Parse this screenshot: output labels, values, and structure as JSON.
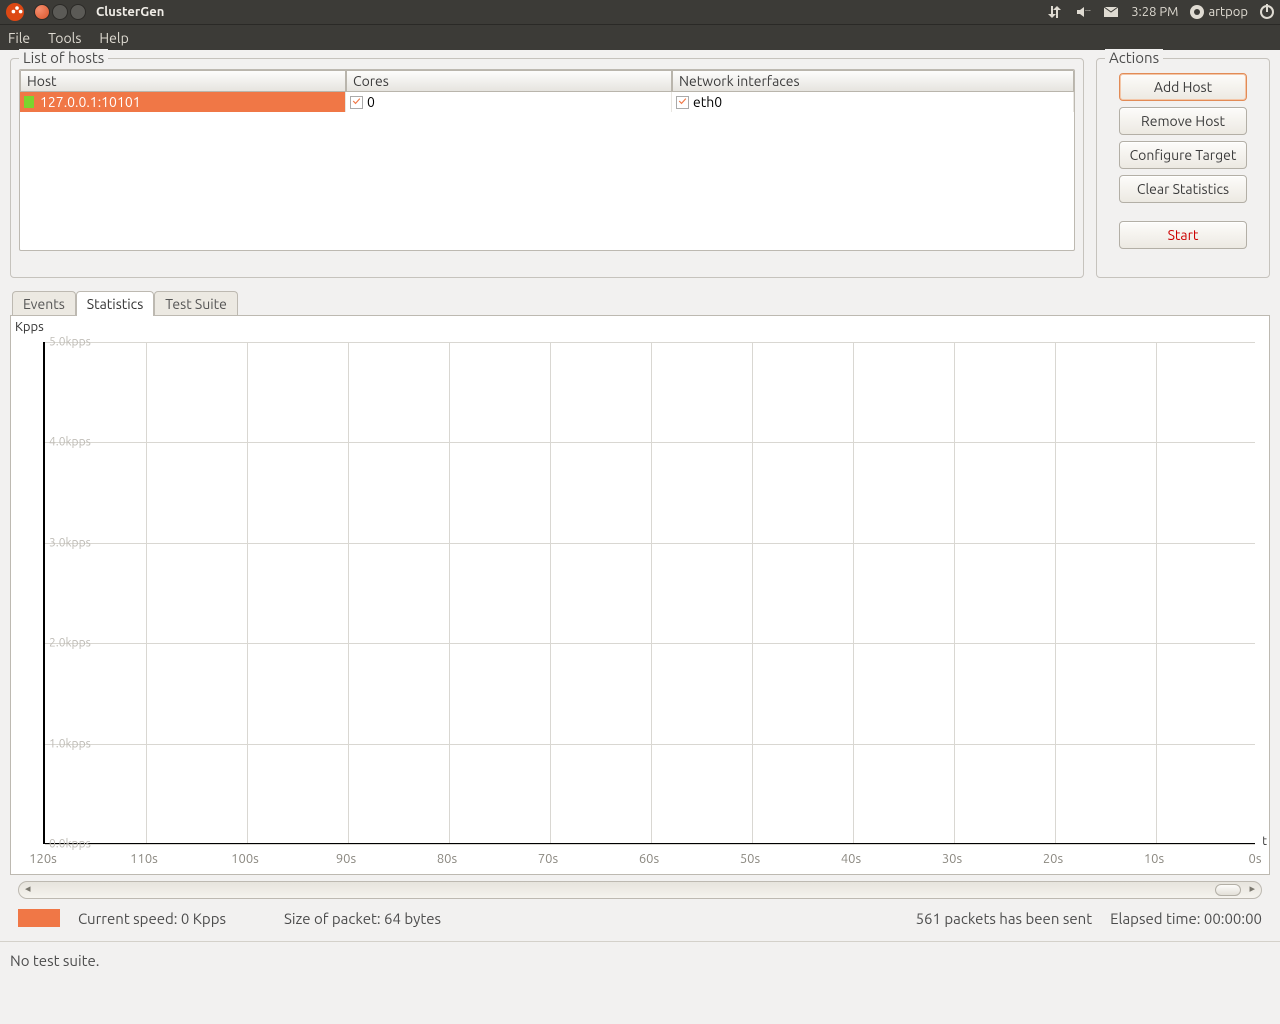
{
  "sys": {
    "title": "ClusterGen",
    "clock": "3:28 PM",
    "user": "artpop"
  },
  "menu": {
    "file": "File",
    "tools": "Tools",
    "help": "Help"
  },
  "hosts": {
    "legend": "List of hosts",
    "headers": {
      "host": "Host",
      "cores": "Cores",
      "net": "Network interfaces"
    },
    "rows": [
      {
        "host": "127.0.0.1:10101",
        "cores": "0",
        "net": "eth0"
      }
    ]
  },
  "actions": {
    "legend": "Actions",
    "add": "Add Host",
    "remove": "Remove Host",
    "configure": "Configure Target",
    "clear": "Clear Statistics",
    "start": "Start"
  },
  "tabs": {
    "events": "Events",
    "statistics": "Statistics",
    "testsuite": "Test Suite"
  },
  "chart": {
    "ylabel": "Kpps",
    "tlabel": "t",
    "yticks": [
      "5.0kpps",
      "4.0kpps",
      "3.0kpps",
      "2.0kpps",
      "1.0kpps",
      "0.0kpps"
    ],
    "xticks": [
      "120s",
      "110s",
      "100s",
      "90s",
      "80s",
      "70s",
      "60s",
      "50s",
      "40s",
      "30s",
      "20s",
      "10s",
      "0s"
    ]
  },
  "chart_data": {
    "type": "line",
    "title": "",
    "xlabel": "t",
    "ylabel": "Kpps",
    "ylim": [
      0,
      5
    ],
    "x": [
      120,
      110,
      100,
      90,
      80,
      70,
      60,
      50,
      40,
      30,
      20,
      10,
      0
    ],
    "series": [
      {
        "name": "127.0.0.1:10101",
        "color": "#f07746",
        "values": [
          0,
          0,
          0,
          0,
          0,
          0,
          0,
          0,
          0,
          0,
          0,
          0,
          0
        ]
      }
    ]
  },
  "status": {
    "speed_label": "Current speed:",
    "speed_value": "0 Kpps",
    "packet_label": "Size of packet:",
    "packet_value": "64 bytes",
    "sent": "561 packets has been sent",
    "elapsed_label": "Elapsed time:",
    "elapsed_value": "00:00:00"
  },
  "footer": {
    "text": "No test suite."
  }
}
